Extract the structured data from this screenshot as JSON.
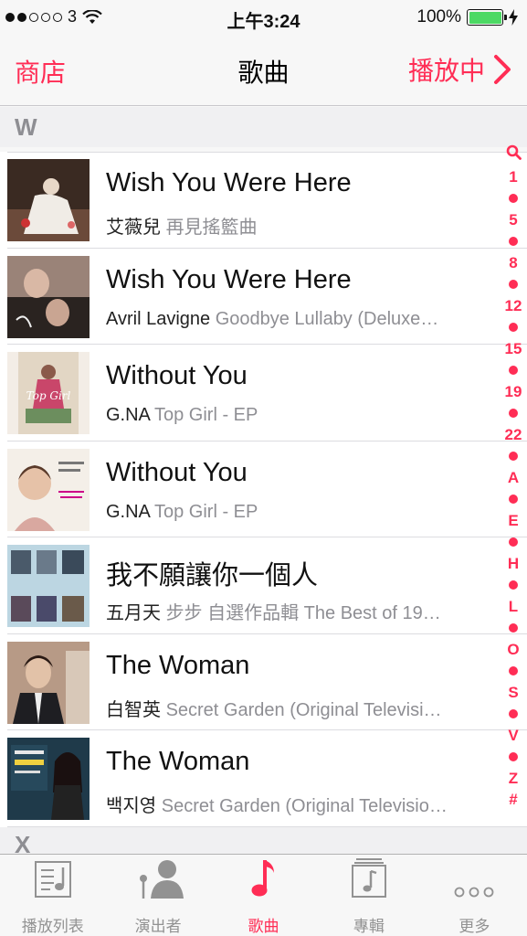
{
  "status": {
    "carrier": "3",
    "time": "上午3:24",
    "battery": "100%",
    "signal_bars_filled": 2,
    "signal_bars_total": 5
  },
  "nav": {
    "left": "商店",
    "title": "歌曲",
    "right": "播放中"
  },
  "sections": [
    "W",
    "X"
  ],
  "songs": [
    {
      "title": "Wish You Were Here",
      "artist": "艾薇兒",
      "album": "再見搖籃曲"
    },
    {
      "title": "Wish You Were Here",
      "artist": "Avril Lavigne",
      "album": "Goodbye Lullaby (Deluxe…"
    },
    {
      "title": "Without You",
      "artist": "G.NA",
      "album": "Top Girl - EP"
    },
    {
      "title": "Without You",
      "artist": "G.NA",
      "album": "Top Girl - EP"
    },
    {
      "title": "我不願讓你一個人",
      "artist": "五月天",
      "album": "步步 自選作品輯 The Best of 19…"
    },
    {
      "title": "The Woman",
      "artist": "白智英",
      "album": "Secret Garden (Original Televisi…"
    },
    {
      "title": "The Woman",
      "artist": "백지영",
      "album": "Secret Garden (Original Televisio…"
    }
  ],
  "index": [
    "search",
    "1",
    "•",
    "5",
    "•",
    "8",
    "•",
    "12",
    "•",
    "15",
    "•",
    "19",
    "•",
    "22",
    "•",
    "A",
    "•",
    "E",
    "•",
    "H",
    "•",
    "L",
    "•",
    "O",
    "•",
    "S",
    "•",
    "V",
    "•",
    "Z",
    "#"
  ],
  "tabs": [
    {
      "label": "播放列表",
      "icon": "playlist-icon",
      "active": false
    },
    {
      "label": "演出者",
      "icon": "artist-icon",
      "active": false
    },
    {
      "label": "歌曲",
      "icon": "music-note-icon",
      "active": true
    },
    {
      "label": "專輯",
      "icon": "album-icon",
      "active": false
    },
    {
      "label": "更多",
      "icon": "more-icon",
      "active": false
    }
  ],
  "colors": {
    "accent": "#ff2d55",
    "battery": "#4cd964",
    "secondary": "#8e8e93"
  }
}
